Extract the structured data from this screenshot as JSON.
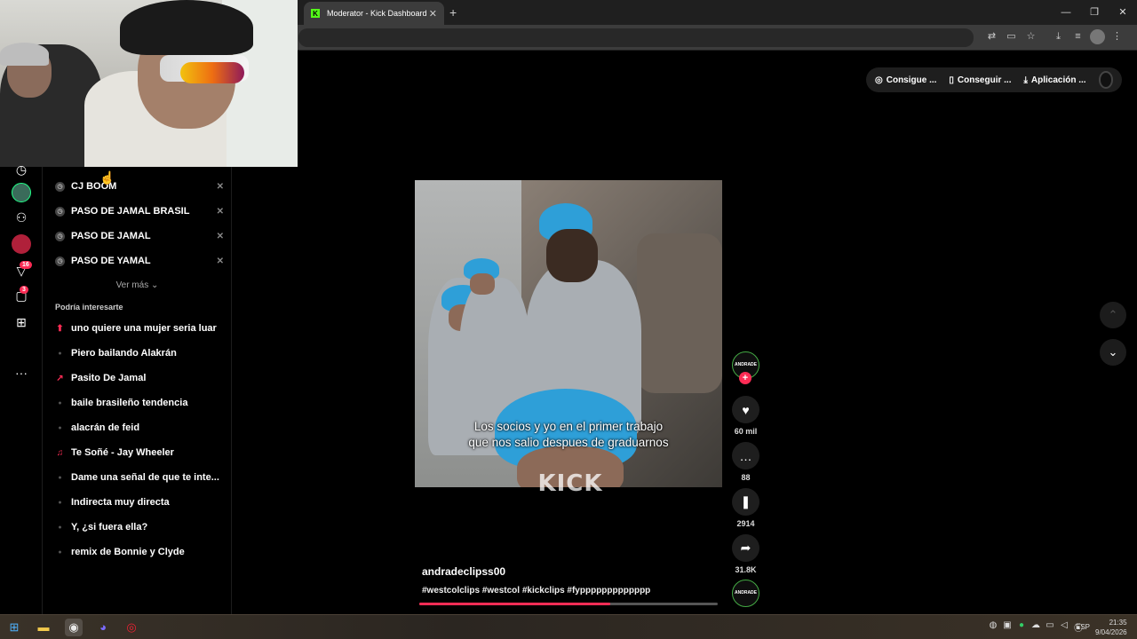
{
  "browser": {
    "tab_title": "Moderator - Kick Dashboard",
    "tab_favicon": "K",
    "tab_close": "✕",
    "new_tab": "+",
    "window_controls": [
      "—",
      "❐",
      "✕"
    ],
    "toolbar_icons": [
      "translate-icon",
      "cast-icon",
      "star-icon",
      "download-icon",
      "media-icon",
      "profile-icon",
      "menu-icon"
    ]
  },
  "rail": {
    "badges": {
      "following": "16",
      "messages": "3"
    },
    "more": "···"
  },
  "search_panel": {
    "history": [
      "CJ BOOM",
      "PASO DE JAMAL BRASIL",
      "PASO DE JAMAL",
      "PASO DE YAMAL"
    ],
    "close_glyph": "✕",
    "see_more": "Ver más",
    "suggestions_title": "Podría interesarte",
    "suggestions": [
      {
        "label": "uno quiere una mujer seria luar",
        "marker": "up"
      },
      {
        "label": "Piero bailando Alakrán",
        "marker": "dot"
      },
      {
        "label": "Pasito De Jamal",
        "marker": "trend"
      },
      {
        "label": "baile brasileño tendencia",
        "marker": "dot"
      },
      {
        "label": "alacrán de feid",
        "marker": "dot"
      },
      {
        "label": "Te Soñé - Jay Wheeler",
        "marker": "music"
      },
      {
        "label": "Dame una señal de que te inte...",
        "marker": "dot"
      },
      {
        "label": "Indirecta muy directa",
        "marker": "dot"
      },
      {
        "label": "Y, ¿si fuera ella?",
        "marker": "dot"
      },
      {
        "label": "remix de Bonnie y Clyde",
        "marker": "dot"
      }
    ]
  },
  "top_pills": {
    "coins": "Consigue ...",
    "get_app": "Conseguir ...",
    "desktop_app": "Aplicación ..."
  },
  "video": {
    "subtitle_line1": "Los socios y yo en el primer trabajo",
    "subtitle_line2": "que nos salio despues de graduarnos",
    "watermark": "KICK",
    "progress": 0.64
  },
  "actions": {
    "creator_avatar_text": "ANDRADE",
    "likes": "60 mil",
    "comments": "88",
    "saves": "2914",
    "shares": "31.8K"
  },
  "caption": {
    "username": "andradeclipss00",
    "hashtags": "#westcolclips #westcol #kickclips #fyppppppppppppp"
  },
  "taskbar": {
    "language": "ESP",
    "time": "21:35",
    "date": "9/04/2026"
  },
  "colors": {
    "accent": "#fe2c55",
    "kick_green": "#53fc18",
    "background": "#000000"
  }
}
